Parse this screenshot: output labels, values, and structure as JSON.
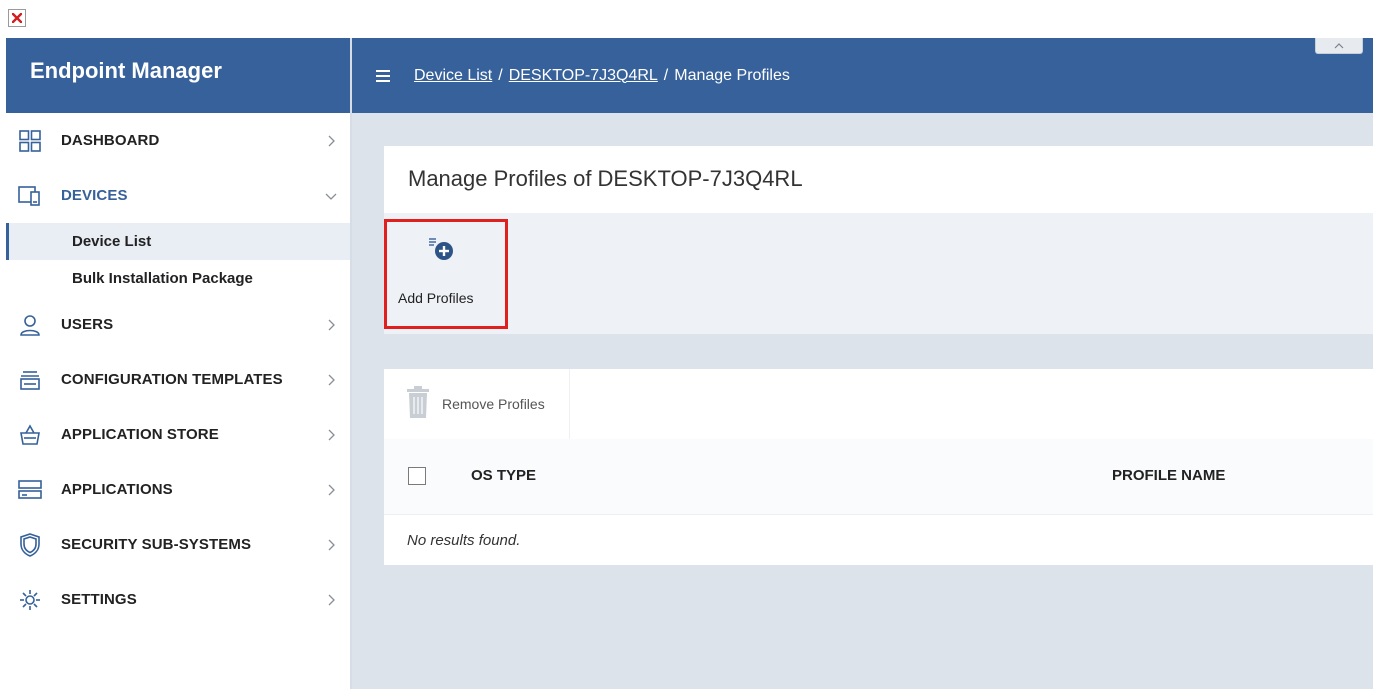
{
  "sidebar": {
    "brand": "Endpoint Manager",
    "items": [
      {
        "label": "DASHBOARD",
        "icon": "dashboard-grid-icon",
        "expanded": false
      },
      {
        "label": "DEVICES",
        "icon": "devices-icon",
        "expanded": true,
        "children": [
          {
            "label": "Device List",
            "active": true
          },
          {
            "label": "Bulk Installation Package",
            "active": false
          }
        ]
      },
      {
        "label": "USERS",
        "icon": "user-icon",
        "expanded": false
      },
      {
        "label": "CONFIGURATION TEMPLATES",
        "icon": "templates-icon",
        "expanded": false
      },
      {
        "label": "APPLICATION STORE",
        "icon": "basket-icon",
        "expanded": false
      },
      {
        "label": "APPLICATIONS",
        "icon": "applications-icon",
        "expanded": false
      },
      {
        "label": "SECURITY SUB-SYSTEMS",
        "icon": "shield-icon",
        "expanded": false
      },
      {
        "label": "SETTINGS",
        "icon": "gear-icon",
        "expanded": false
      }
    ]
  },
  "header": {
    "breadcrumb": [
      {
        "label": "Device List",
        "link": true
      },
      {
        "label": "DESKTOP-7J3Q4RL",
        "link": true
      },
      {
        "label": "Manage Profiles",
        "link": false
      }
    ],
    "separator": "/"
  },
  "page": {
    "title": "Manage Profiles of DESKTOP-7J3Q4RL",
    "add_profiles_label": "Add Profiles",
    "remove_profiles_label": "Remove Profiles",
    "table": {
      "columns": [
        "OS TYPE",
        "PROFILE NAME"
      ],
      "empty_text": "No results found."
    }
  },
  "colors": {
    "brand_blue": "#36619a",
    "highlight_red": "#e0201f",
    "background": "#dde3ea"
  }
}
